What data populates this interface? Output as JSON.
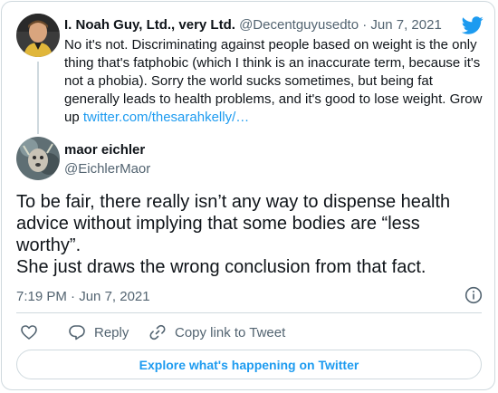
{
  "quoted_tweet": {
    "display_name": "I. Noah Guy, Ltd., very Ltd.",
    "handle": "@Decentguyusedto",
    "separator": "·",
    "date": "Jun 7, 2021",
    "text": "No it's not. Discriminating against people based on weight is the only thing that's fatphobic (which I think is an inaccurate term, because it's not a phobia). Sorry the world sucks sometimes, but being fat generally leads to health problems, and it's good to lose weight. Grow up ",
    "link": "twitter.com/thesarahkelly/…"
  },
  "main_tweet": {
    "display_name": "maor eichler",
    "handle": "@EichlerMaor",
    "text_line1": "To be fair, there really isn’t any way to dispense health advice without implying that some bodies are “less worthy”.",
    "text_line2": "She just draws the wrong conclusion from that fact.",
    "time": "7:19 PM",
    "separator": "·",
    "date": "Jun 7, 2021"
  },
  "actions": {
    "reply_label": "Reply",
    "copy_label": "Copy link to Tweet"
  },
  "explore_label": "Explore what's happening on Twitter",
  "colors": {
    "accent": "#1d9bf0",
    "text": "#0f1419",
    "secondary": "#536471",
    "border": "#cfd9de"
  },
  "icons": [
    "twitter-bird-icon",
    "info-icon",
    "heart-icon",
    "reply-icon",
    "link-icon"
  ]
}
